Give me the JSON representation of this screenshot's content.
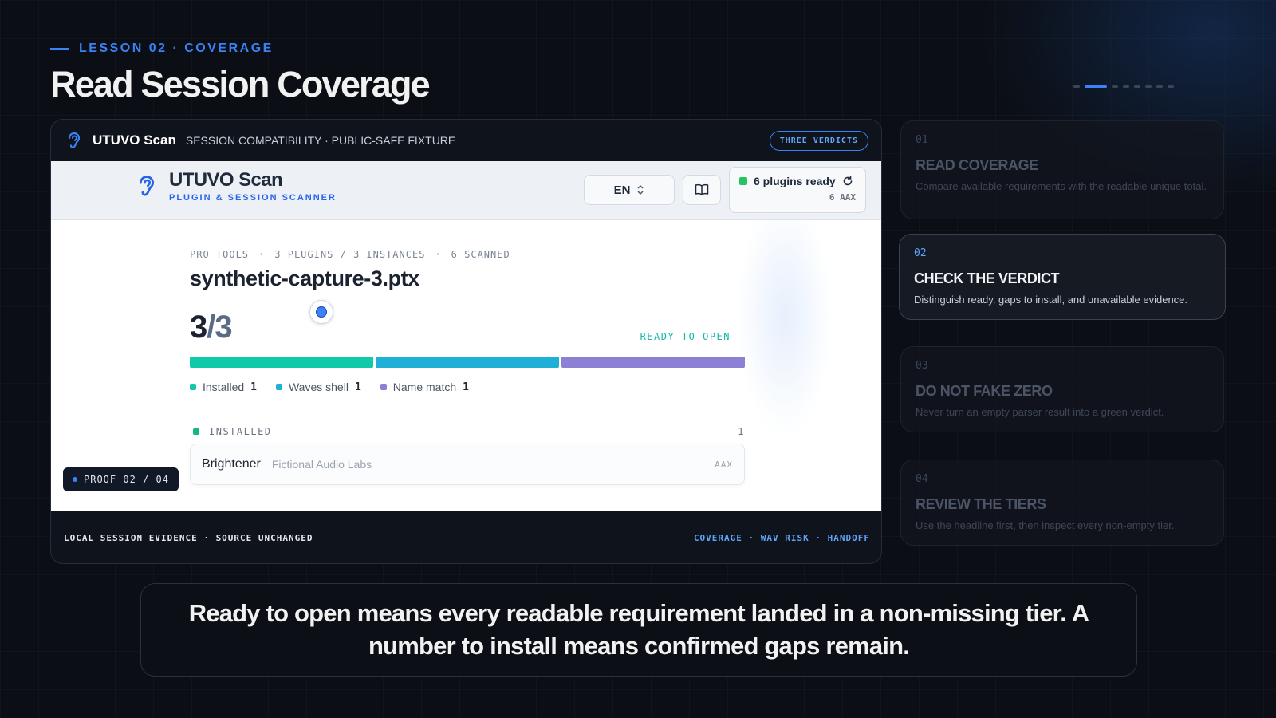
{
  "lesson": {
    "eyebrow": "LESSON 02 · COVERAGE",
    "title": "Read Session Coverage"
  },
  "slides": {
    "count": 8,
    "active_index": 1
  },
  "window": {
    "app_name": "UTUVO Scan",
    "subtitle": "SESSION COMPATIBILITY · PUBLIC-SAFE FIXTURE",
    "pill": "THREE VERDICTS",
    "footer_left": "LOCAL SESSION EVIDENCE · SOURCE UNCHANGED",
    "footer_right": "COVERAGE · WAV RISK · HANDOFF"
  },
  "app": {
    "brand_title": "UTUVO Scan",
    "brand_sub": "PLUGIN & SESSION SCANNER",
    "lang": "EN",
    "ready_text": "6 plugins ready",
    "ready_sub": "6 AAX",
    "meta": [
      "PRO TOOLS",
      "3 PLUGINS / 3 INSTANCES",
      "6 SCANNED"
    ],
    "session_name": "synthetic-capture-3.ptx",
    "count_ready": "3",
    "count_total": "/3",
    "verdict": "READY TO OPEN",
    "legend": [
      {
        "label": "Installed",
        "value": "1",
        "color": "#10c9a8"
      },
      {
        "label": "Waves shell",
        "value": "1",
        "color": "#1fb0d8"
      },
      {
        "label": "Name match",
        "value": "1",
        "color": "#8b7fd6"
      }
    ],
    "tier": {
      "label": "INSTALLED",
      "count": "1"
    },
    "plugin": {
      "name": "Brightener",
      "vendor": "Fictional Audio Labs",
      "format": "AAX"
    },
    "proof": "PROOF 02 / 04"
  },
  "steps": [
    {
      "num": "01",
      "title": "READ COVERAGE",
      "desc": "Compare available requirements with the readable unique total."
    },
    {
      "num": "02",
      "title": "CHECK THE VERDICT",
      "desc": "Distinguish ready, gaps to install, and unavailable evidence."
    },
    {
      "num": "03",
      "title": "DO NOT FAKE ZERO",
      "desc": "Never turn an empty parser result into a green verdict."
    },
    {
      "num": "04",
      "title": "REVIEW THE TIERS",
      "desc": "Use the headline first, then inspect every non-empty tier."
    }
  ],
  "caption": "Ready to open means every readable requirement landed in a non-missing tier. A number to install means confirmed gaps remain."
}
